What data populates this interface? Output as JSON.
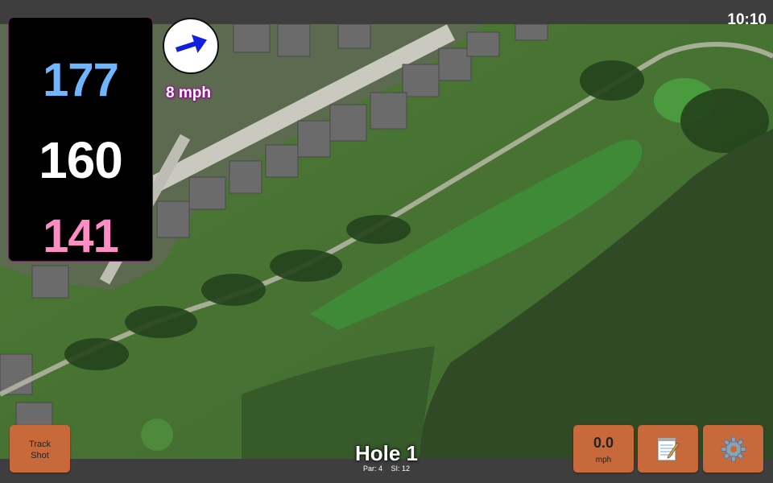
{
  "status": {
    "time": "10:10"
  },
  "distances": {
    "back": "177",
    "center": "160",
    "front": "141"
  },
  "wind": {
    "speed": "8 mph",
    "icon": "arrow-right-icon"
  },
  "hole": {
    "title": "Hole 1",
    "par": "Par: 4",
    "stroke_index": "SI: 12"
  },
  "buttons": {
    "track_shot_line1": "Track",
    "track_shot_line2": "Shot",
    "speed_value": "0.0",
    "speed_unit": "mph",
    "scorecard_icon": "notepad-icon",
    "settings_icon": "gear-icon"
  },
  "colors": {
    "back": "#6eb6ff",
    "center": "#ffffff",
    "front": "#ff8cc4",
    "button": "#c8693c"
  }
}
